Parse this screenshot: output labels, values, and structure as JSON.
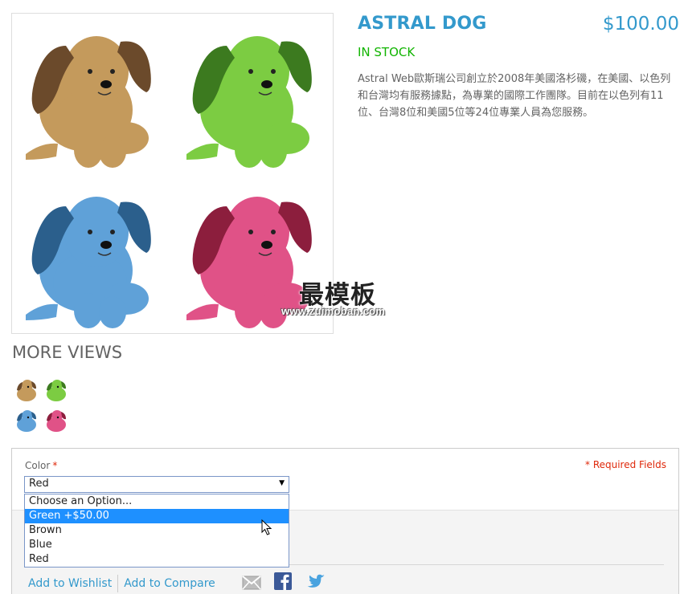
{
  "product": {
    "name": "ASTRAL DOG",
    "price": "$100.00",
    "availability": "IN STOCK",
    "description": "Astral Web歐斯瑞公司創立於2008年美國洛杉磯，在美國、以色列和台灣均有服務據點，為專業的國際工作團隊。目前在以色列有11位、台灣8位和美國5位等24位專業人員為您服務。"
  },
  "watermark": {
    "text": "最模板",
    "url": "www.zuimoban.com"
  },
  "more_views": {
    "title": "MORE VIEWS",
    "thumbnails": [
      {
        "name": "tan",
        "color": "#c49a5c",
        "ear": "#6b4a2b"
      },
      {
        "name": "green",
        "color": "#7ccc42",
        "ear": "#3c7a1f"
      },
      {
        "name": "blue",
        "color": "#5fa1d8",
        "ear": "#2b5f8c"
      },
      {
        "name": "pink",
        "color": "#e05287",
        "ear": "#8c1e3d"
      }
    ]
  },
  "options": {
    "color_label": "Color",
    "required_mark": "*",
    "required_fields": "* Required Fields",
    "selected_value": "Red",
    "dropdown_options": [
      "Choose an Option...",
      "Green +$50.00",
      "Brown",
      "Blue",
      "Red"
    ],
    "highlighted_index": 1
  },
  "actions": {
    "wishlist": "Add to Wishlist",
    "compare": "Add to Compare"
  },
  "colors": {
    "accent": "#3399cc",
    "in_stock": "#11b400",
    "required": "#df280a",
    "highlight": "#1e90ff"
  }
}
